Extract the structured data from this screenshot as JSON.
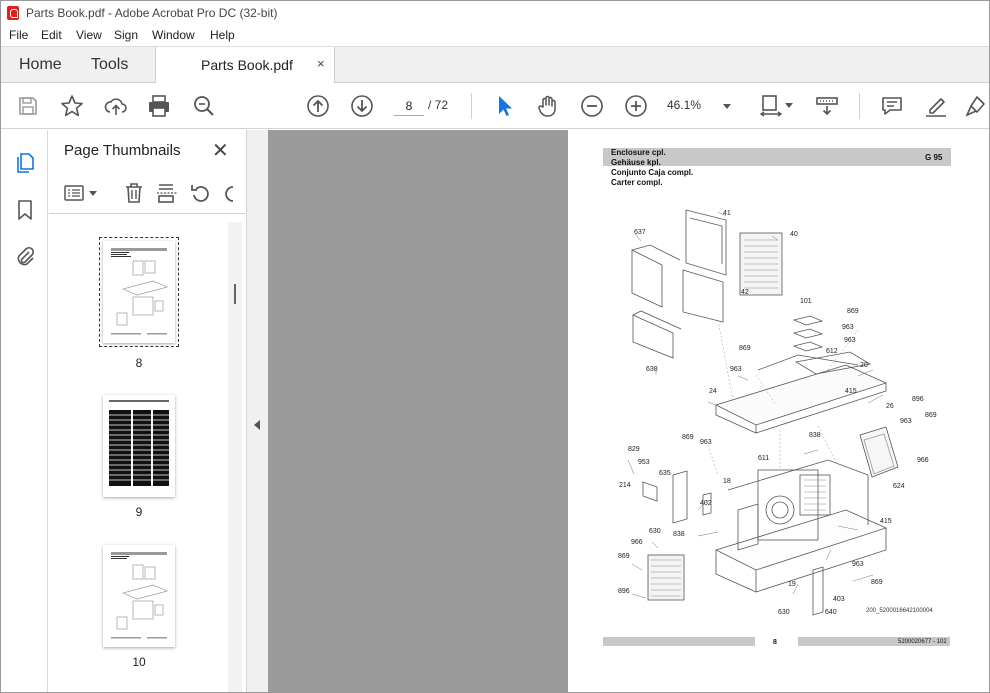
{
  "window": {
    "title": "Parts Book.pdf - Adobe Acrobat Pro DC (32-bit)",
    "accent": "#e0201b"
  },
  "menu": {
    "items": [
      "File",
      "Edit",
      "View",
      "Sign",
      "Window",
      "Help"
    ]
  },
  "tabs": {
    "home": "Home",
    "tools": "Tools",
    "document": "Parts Book.pdf",
    "close": "×"
  },
  "toolbar": {
    "page_current": "8",
    "page_total": "/ 72",
    "zoom": "46.1%",
    "icons": [
      "save-icon",
      "bookmark-star-icon",
      "upload-icon",
      "print-icon",
      "search-zoom-icon",
      "page-up-icon",
      "page-down-icon",
      "select-pointer-icon",
      "hand-icon",
      "zoom-out-icon",
      "zoom-in-icon",
      "fit-page-icon",
      "scroll-mode-icon",
      "comment-icon",
      "highlight-pen-icon",
      "sign-icon"
    ]
  },
  "thumbnails_pane": {
    "title": "Page Thumbnails",
    "close": "✕",
    "pages": [
      {
        "label": "8",
        "selected": true,
        "kind": "drawing"
      },
      {
        "label": "9",
        "selected": false,
        "kind": "table"
      },
      {
        "label": "10",
        "selected": false,
        "kind": "drawing"
      }
    ]
  },
  "document_page": {
    "header_lines": [
      "Enclosure cpl.",
      "Gehäuse kpl.",
      "Conjunto Caja compl.",
      "Carter compl."
    ],
    "code": "G 95",
    "footer_page": "8",
    "footer_ref": "5200020677 - 102",
    "figure_id": "200_5200016642100004",
    "part_numbers": [
      "41",
      "637",
      "40",
      "42",
      "101",
      "869",
      "963",
      "612",
      "963",
      "869",
      "638",
      "20",
      "963",
      "24",
      "415",
      "26",
      "896",
      "869",
      "963",
      "838",
      "869",
      "963",
      "966",
      "829",
      "953",
      "611",
      "635",
      "214",
      "624",
      "18",
      "402",
      "415",
      "630",
      "838",
      "966",
      "869",
      "963",
      "19",
      "403",
      "896",
      "869",
      "630",
      "640"
    ]
  }
}
